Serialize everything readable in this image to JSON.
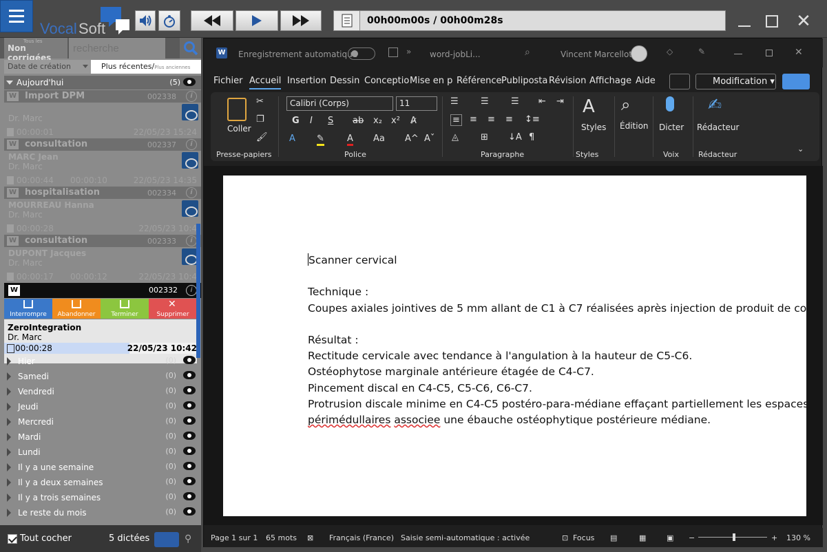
{
  "app": {
    "name": "VocalSoft",
    "time": "00h00m00s / 00h00m28s"
  },
  "colors": {
    "accent": "#2563b0",
    "interrompre": "#3a78c9",
    "abandonner": "#f08c1e",
    "terminer": "#8cc63f",
    "supprimer": "#e05252"
  },
  "left": {
    "filter": "Non corrigées",
    "filter_hint": "Tous les",
    "search_placeholder": "recherche",
    "sort_by": "Date de création",
    "sort_order": "Plus récentes/",
    "sort_order_alt": "Plus anciennes",
    "today": {
      "label": "Aujourd'hui",
      "count": "(5)"
    },
    "records": [
      {
        "title": "Import DPM",
        "num": "002338",
        "patient": "",
        "doctor": "Dr. Marc",
        "dur1": "00:00:01",
        "dur2": "",
        "date": "22/05/23 15:24"
      },
      {
        "title": "consultation",
        "num": "002337",
        "patient": "MARC Jean",
        "doctor": "Dr. Marc",
        "dur1": "00:00:44",
        "dur2": "00:00:10",
        "date": "22/05/23 14:35"
      },
      {
        "title": "hospitalisation",
        "num": "002334",
        "patient": "MOURREAU Hanna",
        "doctor": "Dr. Marc",
        "dur1": "00:00:28",
        "dur2": "",
        "date": "22/05/23 10:4"
      },
      {
        "title": "consultation",
        "num": "002333",
        "patient": "DUPONT Jacques",
        "doctor": "Dr. Marc",
        "dur1": "00:00:17",
        "dur2": "00:00:12",
        "date": "22/05/23 10:4"
      }
    ],
    "selected": {
      "num": "002332",
      "title": "ZeroIntegration",
      "doctor": "Dr. Marc",
      "dur": "00:00:28",
      "date": "22/05/23 10:42"
    },
    "actions": [
      "Interrompre",
      "Abandonner",
      "Terminer",
      "Supprimer"
    ],
    "days": [
      {
        "label": "Hier",
        "count": "(0)"
      },
      {
        "label": "Samedi",
        "count": "(0)"
      },
      {
        "label": "Vendredi",
        "count": "(0)"
      },
      {
        "label": "Jeudi",
        "count": "(0)"
      },
      {
        "label": "Mercredi",
        "count": "(0)"
      },
      {
        "label": "Mardi",
        "count": "(0)"
      },
      {
        "label": "Lundi",
        "count": "(0)"
      },
      {
        "label": "Il y a une semaine",
        "count": "(0)"
      },
      {
        "label": "Il y a deux semaines",
        "count": "(0)"
      },
      {
        "label": "Il y a trois semaines",
        "count": "(0)"
      },
      {
        "label": "Le reste du mois",
        "count": "(0)"
      }
    ],
    "footer": {
      "check_all": "Tout cocher",
      "count": "5 dictées"
    }
  },
  "word": {
    "autosave": "Enregistrement automatique",
    "filename": "word-jobLi...",
    "user": "Vincent Marcellot",
    "tabs": [
      "Fichier",
      "Accueil",
      "Insertion",
      "Dessin",
      "Conceptio",
      "Mise en p",
      "Référence",
      "Publiposta",
      "Révision",
      "Affichage",
      "Aide"
    ],
    "mode": "Modification",
    "font": "Calibri (Corps)",
    "size": "11",
    "groups": [
      "Presse-papiers",
      "Police",
      "Paragraphe",
      "Styles",
      "Voix",
      "Rédacteur"
    ],
    "buttons": {
      "paste": "Coller",
      "styles": "Styles",
      "edition": "Édition",
      "dicter": "Dicter",
      "redacteur": "Rédacteur"
    },
    "doc": {
      "l1": "Scanner cervical",
      "l2": "Technique :",
      "l3": "Coupes axiales jointives de 5 mm allant de C1 à C7 réalisées après injection de produit de con",
      "l4": "Résultat :",
      "l5": "Rectitude cervicale avec tendance à l'angulation à la hauteur de C5-C6.",
      "l6": "Ostéophytose marginale antérieure étagée de C4-C7.",
      "l7": "Pincement discal en C4-C5, C5-C6, C6-C7.",
      "l8": "Protrusion discale minime en C4-C5 postéro-para-médiane effaçant partiellement les espaces",
      "l9a": "périmédullaires",
      "l9b": "associee",
      "l9c": " une ébauche ostéophytique postérieure médiane."
    },
    "status": {
      "page": "Page 1 sur 1",
      "words": "65 mots",
      "lang": "Français (France)",
      "predict": "Saisie semi-automatique : activée",
      "focus": "Focus",
      "zoom": "130 %"
    }
  }
}
